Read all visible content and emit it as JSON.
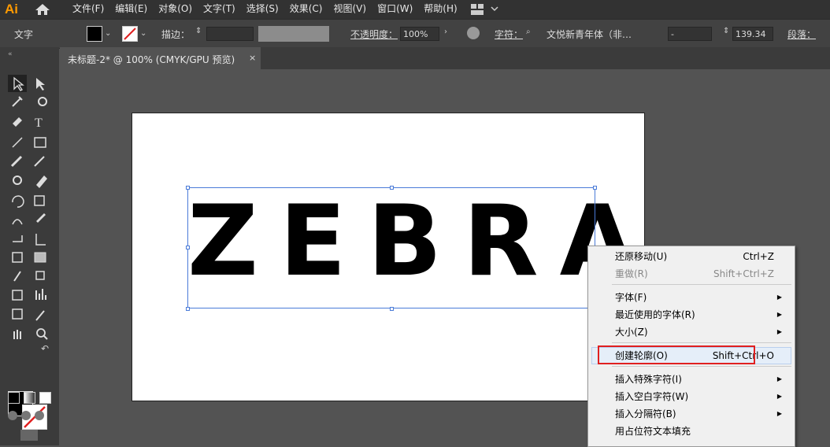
{
  "app": {
    "logo": "Ai"
  },
  "menubar": {
    "items": [
      "文件(F)",
      "编辑(E)",
      "对象(O)",
      "文字(T)",
      "选择(S)",
      "效果(C)",
      "视图(V)",
      "窗口(W)",
      "帮助(H)"
    ]
  },
  "options": {
    "context_label": "文字",
    "stroke_label": "描边：",
    "opacity_label": "不透明度：",
    "opacity_value": "100%",
    "char_label": "字符：",
    "font_name": "文悦新青年体（非…",
    "font_style": "-",
    "font_size": "139.34",
    "para_label": "段落："
  },
  "document": {
    "tab_title": "未标题-2* @ 100% (CMYK/GPU 预览)",
    "close_glyph": "×",
    "artwork_text": "ZEBRA"
  },
  "context_menu": {
    "undo": "还原移动(U)",
    "undo_sc": "Ctrl+Z",
    "redo": "重做(R)",
    "redo_sc": "Shift+Ctrl+Z",
    "font": "字体(F)",
    "recent_fonts": "最近使用的字体(R)",
    "size": "大小(Z)",
    "outline": "创建轮廓(O)",
    "outline_sc": "Shift+Ctrl+O",
    "special_char": "插入特殊字符(I)",
    "whitespace": "插入空白字符(W)",
    "break_char": "插入分隔符(B)",
    "placeholder": "用占位符文本填充"
  },
  "colors": {
    "accent": "#ff9a00",
    "highlight": "#e02020",
    "selection": "#4a7bd8"
  }
}
